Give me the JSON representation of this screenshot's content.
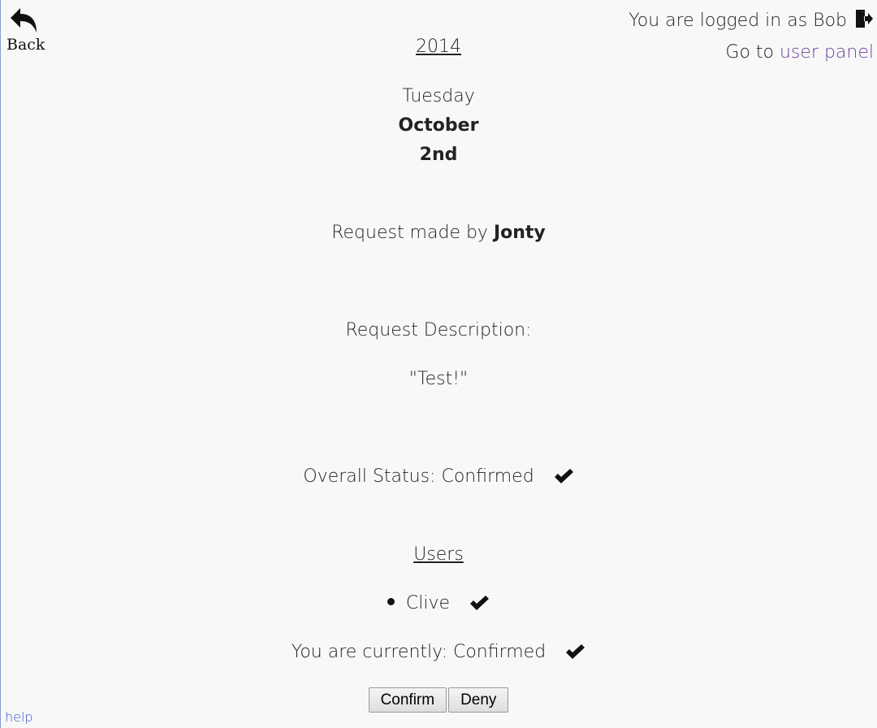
{
  "nav": {
    "back_label": "Back"
  },
  "session": {
    "logged_in_text": "You are logged in as Bob",
    "goto_text": "Go to",
    "user_panel_link": "user panel"
  },
  "date": {
    "year": "2014",
    "weekday": "Tuesday",
    "month": "October",
    "day": "2nd"
  },
  "request": {
    "made_by_text": "Request made by",
    "made_by_name": "Jonty",
    "description_label": "Request Description:",
    "description": "\"Test!\""
  },
  "status": {
    "overall_text": "Overall Status: Confirmed",
    "overall_icon": "checkmark-icon"
  },
  "users": {
    "heading": "Users",
    "items": [
      {
        "name": "Clive",
        "status_icon": "checkmark-icon"
      }
    ]
  },
  "current": {
    "text": "You are currently: Confirmed",
    "icon": "checkmark-icon"
  },
  "actions": {
    "confirm_label": "Confirm",
    "deny_label": "Deny"
  },
  "footer": {
    "help_link": "help"
  },
  "colors": {
    "background": "#f8f8f8",
    "link_visited": "#6a3f9e",
    "help_link": "#3b4fc4"
  }
}
